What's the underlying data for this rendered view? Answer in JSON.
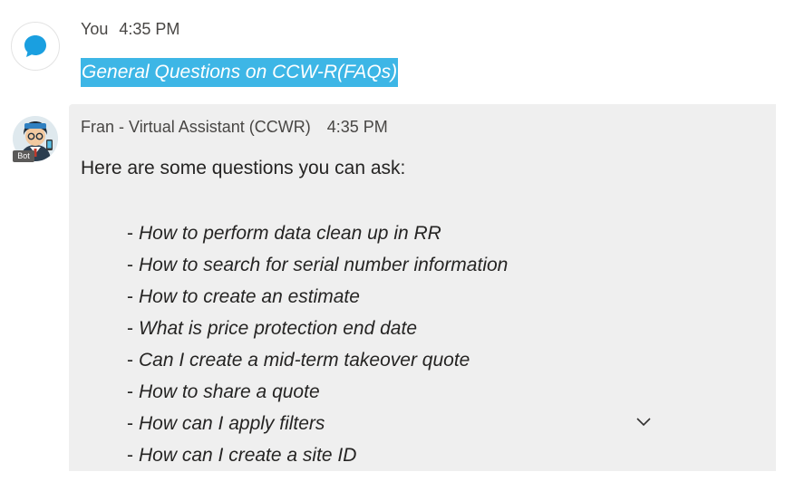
{
  "user_message": {
    "sender": "You",
    "time": "4:35 PM",
    "text": "General Questions on CCW-R(FAQs)",
    "avatar_icon": "chat-bubble-icon",
    "highlight_color": "#3db6e6"
  },
  "bot_message": {
    "sender": "Fran - Virtual Assistant (CCWR)",
    "time": "4:35 PM",
    "badge": "Bot",
    "avatar_icon": "bot-avatar-icon",
    "intro": "Here are some questions you can ask:",
    "questions": [
      "How to perform data clean up in RR",
      "How to search for serial number information",
      "How to create an estimate",
      "What is price protection end date",
      "Can I create a mid-term takeover quote",
      "How to share a quote",
      "How can I apply filters",
      "How can I create a site ID"
    ],
    "bubble_color": "#efefef"
  },
  "controls": {
    "scroll_icon": "chevron-down-icon"
  }
}
